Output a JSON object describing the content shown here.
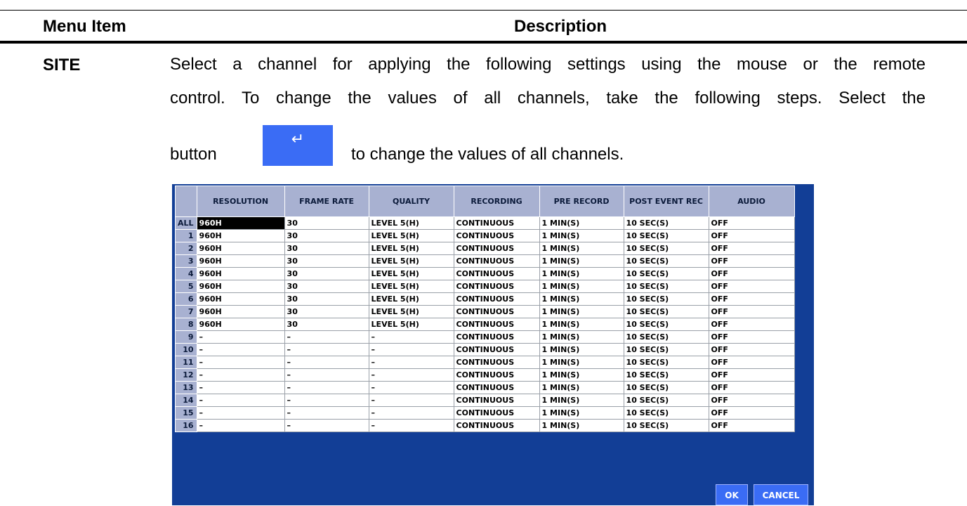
{
  "header": {
    "menu_item": "Menu Item",
    "description": "Description"
  },
  "item": {
    "label": "SITE",
    "line1": "Select a channel for applying the following settings using the mouse or the remote",
    "line2": "control. To change the values of all channels, take the following steps. Select the",
    "line3_before": "button",
    "line3_after": "to change the values of all channels.",
    "enter_icon": "↵"
  },
  "dvr": {
    "columns": [
      "",
      "RESOLUTION",
      "FRAME RATE",
      "QUALITY",
      "RECORDING",
      "PRE RECORD",
      "POST EVENT REC",
      "AUDIO"
    ],
    "rows": [
      [
        "ALL",
        "960H",
        "30",
        "LEVEL 5(H)",
        "CONTINUOUS",
        "1 MIN(S)",
        "10 SEC(S)",
        "OFF"
      ],
      [
        "1",
        "960H",
        "30",
        "LEVEL 5(H)",
        "CONTINUOUS",
        "1 MIN(S)",
        "10 SEC(S)",
        "OFF"
      ],
      [
        "2",
        "960H",
        "30",
        "LEVEL 5(H)",
        "CONTINUOUS",
        "1 MIN(S)",
        "10 SEC(S)",
        "OFF"
      ],
      [
        "3",
        "960H",
        "30",
        "LEVEL 5(H)",
        "CONTINUOUS",
        "1 MIN(S)",
        "10 SEC(S)",
        "OFF"
      ],
      [
        "4",
        "960H",
        "30",
        "LEVEL 5(H)",
        "CONTINUOUS",
        "1 MIN(S)",
        "10 SEC(S)",
        "OFF"
      ],
      [
        "5",
        "960H",
        "30",
        "LEVEL 5(H)",
        "CONTINUOUS",
        "1 MIN(S)",
        "10 SEC(S)",
        "OFF"
      ],
      [
        "6",
        "960H",
        "30",
        "LEVEL 5(H)",
        "CONTINUOUS",
        "1 MIN(S)",
        "10 SEC(S)",
        "OFF"
      ],
      [
        "7",
        "960H",
        "30",
        "LEVEL 5(H)",
        "CONTINUOUS",
        "1 MIN(S)",
        "10 SEC(S)",
        "OFF"
      ],
      [
        "8",
        "960H",
        "30",
        "LEVEL 5(H)",
        "CONTINUOUS",
        "1 MIN(S)",
        "10 SEC(S)",
        "OFF"
      ],
      [
        "9",
        "–",
        "–",
        "–",
        "CONTINUOUS",
        "1 MIN(S)",
        "10 SEC(S)",
        "OFF"
      ],
      [
        "10",
        "–",
        "–",
        "–",
        "CONTINUOUS",
        "1 MIN(S)",
        "10 SEC(S)",
        "OFF"
      ],
      [
        "11",
        "–",
        "–",
        "–",
        "CONTINUOUS",
        "1 MIN(S)",
        "10 SEC(S)",
        "OFF"
      ],
      [
        "12",
        "–",
        "–",
        "–",
        "CONTINUOUS",
        "1 MIN(S)",
        "10 SEC(S)",
        "OFF"
      ],
      [
        "13",
        "–",
        "–",
        "–",
        "CONTINUOUS",
        "1 MIN(S)",
        "10 SEC(S)",
        "OFF"
      ],
      [
        "14",
        "–",
        "–",
        "–",
        "CONTINUOUS",
        "1 MIN(S)",
        "10 SEC(S)",
        "OFF"
      ],
      [
        "15",
        "–",
        "–",
        "–",
        "CONTINUOUS",
        "1 MIN(S)",
        "10 SEC(S)",
        "OFF"
      ],
      [
        "16",
        "–",
        "–",
        "–",
        "CONTINUOUS",
        "1 MIN(S)",
        "10 SEC(S)",
        "OFF"
      ]
    ],
    "selected_cell": "960H",
    "ok_label": "OK",
    "cancel_label": "CANCEL",
    "colors": {
      "panel_bg": "#123e96",
      "header_bg": "#a8b1d1",
      "button_bg": "#3a6cf5"
    }
  }
}
